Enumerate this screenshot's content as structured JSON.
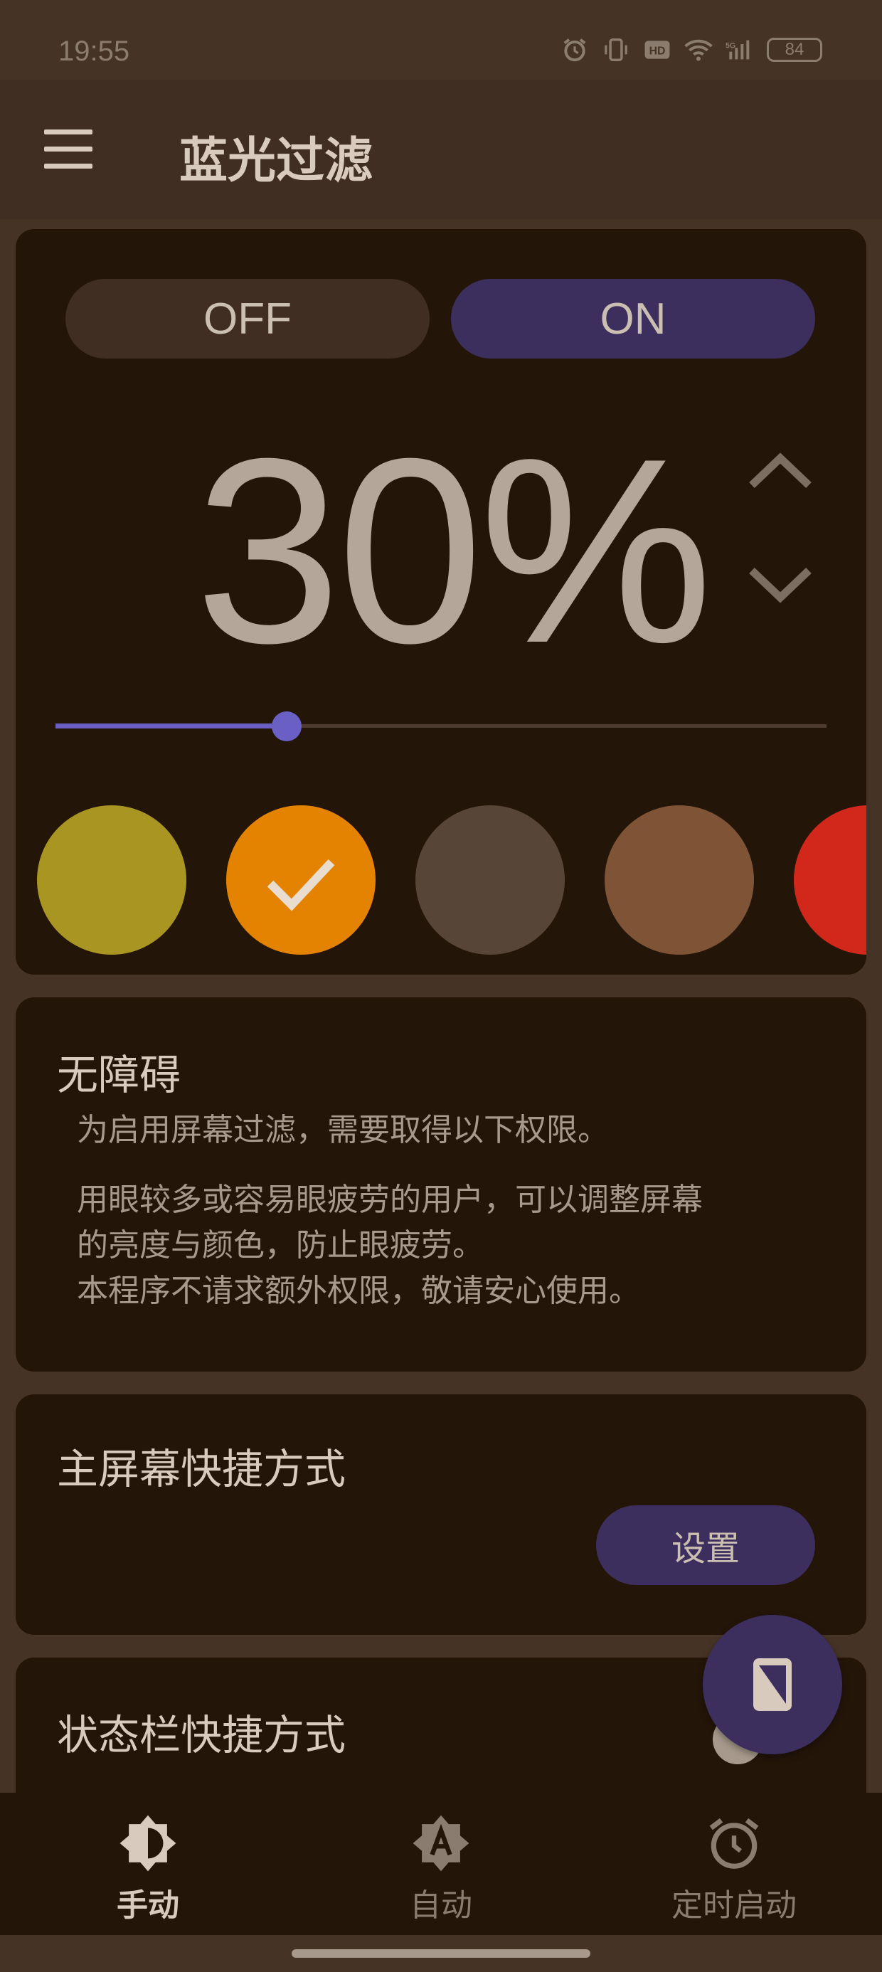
{
  "status_bar": {
    "time": "19:55",
    "battery": "84",
    "network": "5G"
  },
  "app_bar": {
    "title": "蓝光过滤",
    "menu_icon": "hamburger-menu-icon"
  },
  "filter": {
    "off_label": "OFF",
    "on_label": "ON",
    "selected": "ON",
    "intensity_text": "30%",
    "intensity_value": 30,
    "slider_fraction": 0.3,
    "colors": [
      {
        "name": "yellow-swatch",
        "hex": "#a89522",
        "selected": false
      },
      {
        "name": "orange-swatch",
        "hex": "#e48302",
        "selected": true
      },
      {
        "name": "dark-brown-swatch",
        "hex": "#574537",
        "selected": false
      },
      {
        "name": "brown-swatch",
        "hex": "#7f5336",
        "selected": false
      },
      {
        "name": "red-swatch",
        "hex": "#d2271b",
        "selected": false
      }
    ]
  },
  "accessibility": {
    "title": "无障碍",
    "line1": "为启用屏幕过滤，需要取得以下权限。",
    "line2": "用眼较多或容易眼疲劳的用户，可以调整屏幕",
    "line3": "的亮度与颜色，防止眼疲劳。",
    "line4": "本程序不请求额外权限，敬请安心使用。"
  },
  "home_shortcut": {
    "title": "主屏幕快捷方式",
    "button_label": "设置"
  },
  "statusbar_shortcut": {
    "title": "状态栏快捷方式"
  },
  "fab": {
    "icon": "phone-screen-icon"
  },
  "bottom_nav": {
    "items": [
      {
        "label": "手动",
        "icon": "brightness-half-icon",
        "active": true
      },
      {
        "label": "自动",
        "icon": "auto-brightness-icon",
        "active": false
      },
      {
        "label": "定时启动",
        "icon": "alarm-clock-icon",
        "active": false
      }
    ]
  },
  "colors": {
    "background": "#453426",
    "card": "#241509",
    "accent": "#3c2f5e",
    "slider": "#6a5fc4"
  }
}
